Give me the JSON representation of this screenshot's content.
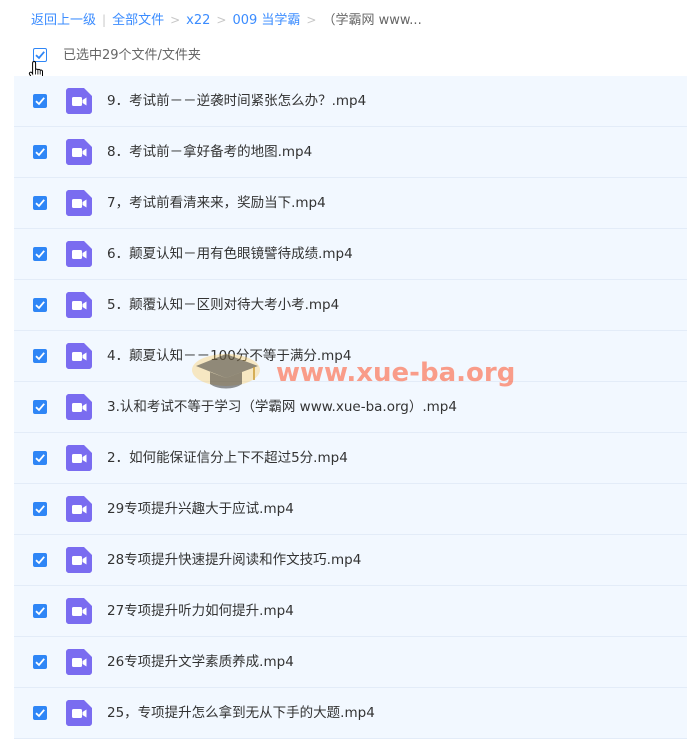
{
  "breadcrumb": {
    "back": "返回上一级",
    "all_files": "全部文件",
    "folder1": "x22",
    "folder2": "009 当学霸",
    "current": "（学霸网 www...",
    "divider": "|",
    "arrow": ">"
  },
  "selection": {
    "label": "已选中29个文件/文件夹"
  },
  "watermark": {
    "text": "www.xue-ba.org"
  },
  "colors": {
    "accent": "#2f86f6",
    "file_icon": "#7a6cf0",
    "row_bg": "#f2f8ff"
  },
  "files": [
    {
      "name": "9．考试前－－逆袭时间紧张怎么办？.mp4",
      "icon": "video-file-icon",
      "checked": true
    },
    {
      "name": "8．考试前－拿好备考的地图.mp4",
      "icon": "video-file-icon",
      "checked": true
    },
    {
      "name": "7，考试前看清来来，奖励当下.mp4",
      "icon": "video-file-icon",
      "checked": true
    },
    {
      "name": "6．颠夏认知－用有色眼镜譬待成绩.mp4",
      "icon": "video-file-icon",
      "checked": true
    },
    {
      "name": "5．颠覆认知－区则对待大考小考.mp4",
      "icon": "video-file-icon",
      "checked": true
    },
    {
      "name": "4．颠夏认知－－100分不等于满分.mp4",
      "icon": "video-file-icon",
      "checked": true
    },
    {
      "name": "3.认和考试不等于学习（学霸网 www.xue-ba.org）.mp4",
      "icon": "video-file-icon",
      "checked": true
    },
    {
      "name": "2．如何能保证信分上下不超过5分.mp4",
      "icon": "video-file-icon",
      "checked": true
    },
    {
      "name": "29专项提升兴趣大于应试.mp4",
      "icon": "video-file-icon",
      "checked": true
    },
    {
      "name": "28专项提升快速提升阅读和作文技巧.mp4",
      "icon": "video-file-icon",
      "checked": true
    },
    {
      "name": "27专项提升听力如何提升.mp4",
      "icon": "video-file-icon",
      "checked": true
    },
    {
      "name": "26专项提升文学素质养成.mp4",
      "icon": "video-file-icon",
      "checked": true
    },
    {
      "name": "25，专项提升怎么拿到无从下手的大题.mp4",
      "icon": "video-file-icon",
      "checked": true
    }
  ]
}
